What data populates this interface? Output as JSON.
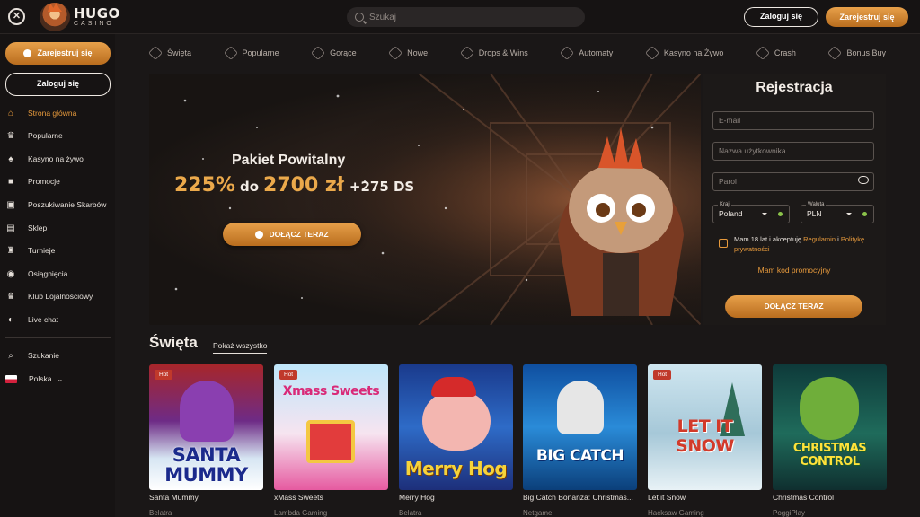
{
  "header": {
    "logo_main": "HUGO",
    "logo_sub": "CASINO",
    "search_placeholder": "Szukaj",
    "login_label": "Zaloguj się",
    "register_label": "Zarejestruj się"
  },
  "sidebar": {
    "register_label": "Zarejestruj się",
    "login_label": "Zaloguj się",
    "items": [
      {
        "label": "Strona główna",
        "icon": "home-icon"
      },
      {
        "label": "Popularne",
        "icon": "crown-icon"
      },
      {
        "label": "Kasyno na żywo",
        "icon": "cards-icon"
      },
      {
        "label": "Promocje",
        "icon": "gift-icon"
      },
      {
        "label": "Poszukiwanie Skarbów",
        "icon": "treasure-icon"
      },
      {
        "label": "Sklep",
        "icon": "shop-icon"
      },
      {
        "label": "Turnieje",
        "icon": "trophy-icon"
      },
      {
        "label": "Osiągnięcia",
        "icon": "medal-icon"
      },
      {
        "label": "Klub Lojalnościowy",
        "icon": "crown-icon"
      },
      {
        "label": "Live chat",
        "icon": "chat-icon"
      }
    ],
    "search_label": "Szukanie",
    "language_label": "Polska"
  },
  "categories": [
    "Święta",
    "Popularne",
    "Gorące",
    "Nowe",
    "Drops & Wins",
    "Automaty",
    "Kasyno na Żywo",
    "Crash",
    "Bonus Buy"
  ],
  "hero": {
    "title": "Pakiet Powitalny",
    "percent": "225%",
    "up_to": "do",
    "amount": "2700 zł",
    "spins": "+275 DS",
    "cta": "DOŁĄCZ TERAZ"
  },
  "registration": {
    "title": "Rejestracja",
    "email_placeholder": "E-mail",
    "username_placeholder": "Nazwa użytkownika",
    "password_placeholder": "Parol",
    "country_label": "Kraj",
    "country_value": "Poland",
    "currency_label": "Waluta",
    "currency_value": "PLN",
    "terms_prefix": "Mam 18 lat i akceptuję",
    "terms_link1": "Regulamin",
    "terms_and": "i",
    "terms_link2": "Politykę prywatności",
    "promo_link": "Mam kod promocyjny",
    "submit_label": "DOŁĄCZ TERAZ"
  },
  "section": {
    "title": "Święta",
    "show_all": "Pokaż wszystko"
  },
  "games": [
    {
      "title": "Santa Mummy",
      "provider": "Belatra",
      "hot": "Hot",
      "art_text": "SANTA MUMMY"
    },
    {
      "title": "xMass Sweets",
      "provider": "Lambda Gaming",
      "hot": "Hot",
      "art_text": "Xmass Sweets"
    },
    {
      "title": "Merry Hog",
      "provider": "Belatra",
      "hot": "",
      "art_text": "Merry Hog"
    },
    {
      "title": "Big Catch Bonanza: Christmas...",
      "provider": "Netgame",
      "hot": "",
      "art_text": "BIG CATCH"
    },
    {
      "title": "Let it Snow",
      "provider": "Hacksaw Gaming",
      "hot": "Hot",
      "art_text": "LET IT SNOW"
    },
    {
      "title": "Christmas Control",
      "provider": "PoggiPlay",
      "hot": "",
      "art_text": "CHRISTMAS CONTROL"
    }
  ],
  "colors": {
    "accent": "#e79a3c",
    "background": "#1a1717",
    "hot_badge": "#c0392b"
  }
}
